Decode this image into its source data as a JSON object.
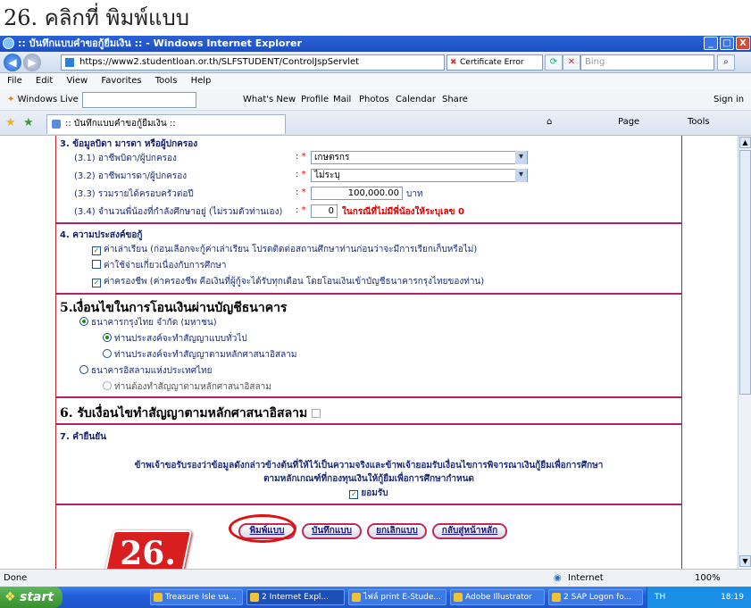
{
  "heading": "26. คลิกที่ พิมพ์แบบ",
  "window": {
    "title": ":: บันทึกแบบคำขอกู้ยืมเงิน :: - Windows Internet Explorer",
    "min": "_",
    "max": "□",
    "close": "X"
  },
  "nav": {
    "back": "◀",
    "forward": "▶",
    "url": "https://www2.studentloan.or.th/SLFSTUDENT/ControlJspServlet",
    "cert": "Certificate Error",
    "search_placeholder": "Bing"
  },
  "menu": [
    "File",
    "Edit",
    "View",
    "Favorites",
    "Tools",
    "Help"
  ],
  "links": {
    "windows_live": "Windows Live",
    "items": [
      "What's New",
      "Profile",
      "Mail",
      "Photos",
      "Calendar",
      "Share"
    ],
    "sign_in": "Sign in"
  },
  "tab": {
    "title": ":: บันทึกแบบคำขอกู้ยืมเงิน ::"
  },
  "toolbar": {
    "page": "Page",
    "tools": "Tools"
  },
  "form": {
    "s3": {
      "title": "3. ข้อมูลบิดา มารดา หรือผู้ปกครอง",
      "father_label": "(3.1) อาชีพบิดา/ผู้ปกครอง",
      "father_value": "เกษตรกร",
      "mother_label": "(3.2) อาชีพมารดา/ผู้ปกครอง",
      "mother_value": "ไม่ระบุ",
      "income_label": "(3.3) รวมรายได้ครอบครัวต่อปี",
      "income_value": "100,000.00",
      "income_unit": "บาท",
      "siblings_label": "(3.4) จำนวนพี่น้องที่กำลังศึกษาอยู่ (ไม่รวมตัวท่านเอง)",
      "siblings_value": "0",
      "siblings_note": "ในกรณีที่ไม่มีพี่น้องให้ระบุเลข 0",
      "colon": ":",
      "required": "*"
    },
    "s4": {
      "title": "4. ความประสงค์ขอกู้",
      "opt1": "ค่าเล่าเรียน (ก่อนเลือกจะกู้ค่าเล่าเรียน โปรดติดต่อสถานศึกษาท่านก่อนว่าจะมีการเรียกเก็บหรือไม่)",
      "opt2": "ค่าใช้จ่ายเกี่ยวเนื่องกับการศึกษา",
      "opt3": "ค่าครองชีพ (ค่าครองชีพ คือเงินที่ผู้กู้จะได้รับทุกเดือน โดยโอนเงินเข้าบัญชีธนาคารกรุงไทยของท่าน)"
    },
    "s5": {
      "title": "5.เงื่อนไขในการโอนเงินผ่านบัญชีธนาคาร",
      "bank1": "ธนาคารกรุงไทย จำกัด (มหาชน)",
      "bank1_opt1": "ท่านประสงค์จะทำสัญญาแบบทั่วไป",
      "bank1_opt2": "ท่านประสงค์จะทำสัญญาตามหลักศาสนาอิสลาม",
      "bank2": "ธนาคารอิสลามแห่งประเทศไทย",
      "bank2_opt1": "ท่านต้องทำสัญญาตามหลักศาสนาอิสลาม"
    },
    "s6": {
      "title": "6. รับเงื่อนไขทำสัญญาตามหลักศาสนาอิสลาม"
    },
    "s7": {
      "title": "7. คำยืนยัน",
      "text1": "ข้าพเจ้าขอรับรองว่าข้อมูลดังกล่าวข้างต้นที่ให้ไว้เป็นความจริงและข้าพเจ้ายอมรับเงื่อนไขการพิจารณาเงินกู้ยืมเพื่อการศึกษา",
      "text2": "ตามหลักเกณฑ์ที่กองทุนเงินให้กู้ยืมเพื่อการศึกษากำหนด",
      "accept": "ยอมรับ"
    },
    "buttons": {
      "print": "พิมพ์แบบ",
      "save": "บันทึกแบบ",
      "cancel": "ยกเลิกแบบ",
      "home": "กลับสู่หน้าหลัก"
    }
  },
  "callout": "26.",
  "status": {
    "left": "Done",
    "zone": "Internet",
    "zoom": "100%"
  },
  "taskbar": {
    "start": "start",
    "tasks": [
      "Treasure Isle บน...",
      "2 Internet Expl...",
      "ไฟล์ print E-Stude...",
      "Adobe Illustrator",
      "2 SAP Logon fo..."
    ],
    "lang": "TH",
    "clock": "18:19"
  }
}
